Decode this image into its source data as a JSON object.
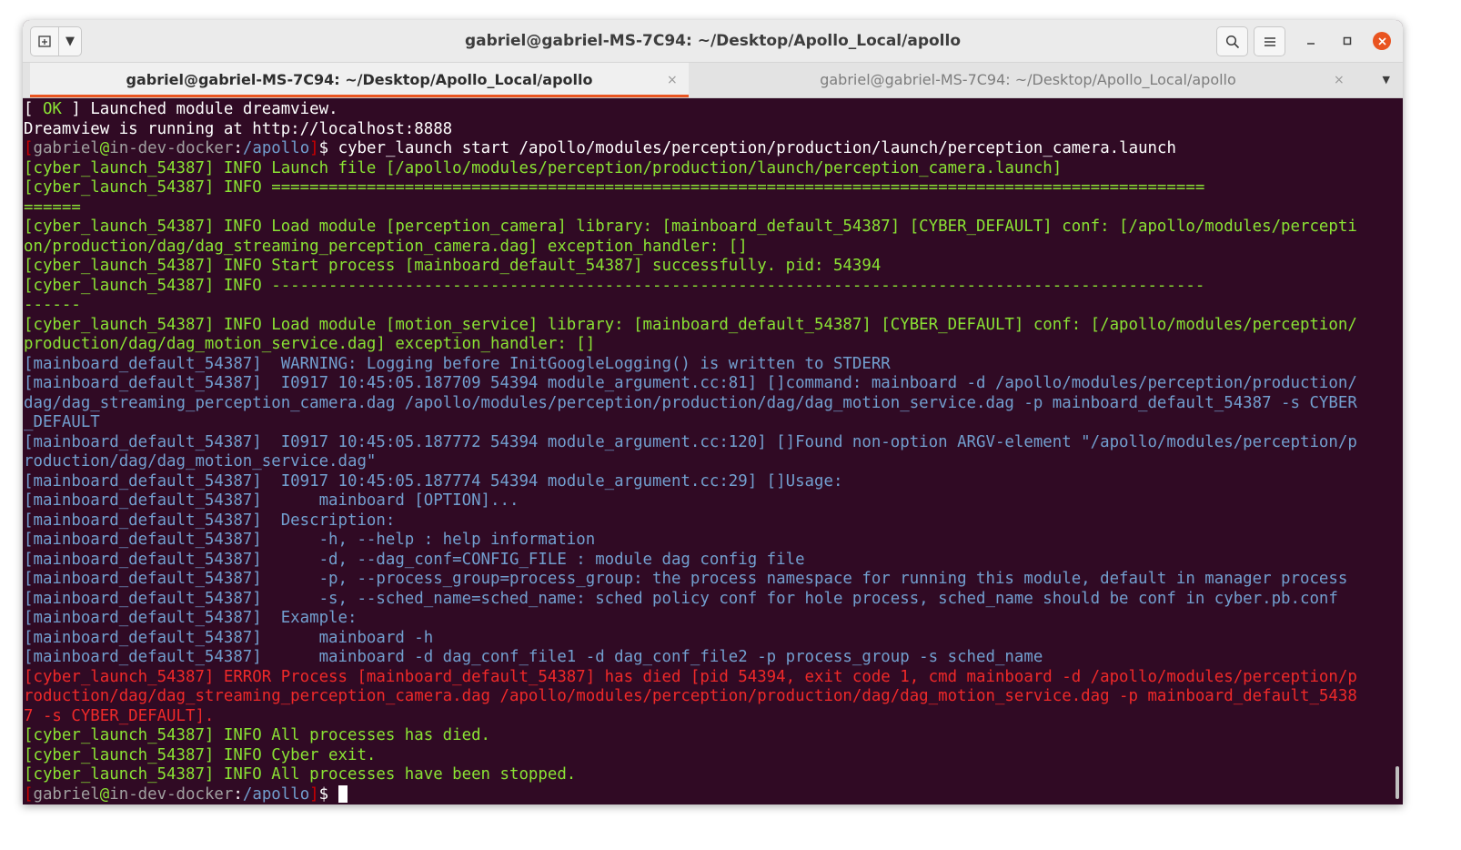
{
  "window": {
    "title": "gabriel@gabriel-MS-7C94: ~/Desktop/Apollo_Local/apollo",
    "search_icon": "search-icon",
    "menu_icon": "hamburger-icon"
  },
  "tabs": [
    {
      "label": "gabriel@gabriel-MS-7C94: ~/Desktop/Apollo_Local/apollo",
      "active": true
    },
    {
      "label": "gabriel@gabriel-MS-7C94: ~/Desktop/Apollo_Local/apollo",
      "active": false
    }
  ],
  "colors": {
    "terminal_bg": "#300a24",
    "accent": "#e95420",
    "green": "#8ae234",
    "blue": "#729fcf",
    "red": "#ef2929"
  },
  "terminal": {
    "prompt": {
      "user": "gabriel",
      "at": "@",
      "host": "in-dev-docker",
      "colon": ":",
      "path": "/apollo",
      "dollar": "$"
    },
    "lines": [
      [
        {
          "t": "[ ",
          "c": "c-white"
        },
        {
          "t": "OK",
          "c": "c-ok"
        },
        {
          "t": " ] Launched module dreamview.",
          "c": "c-white"
        }
      ],
      [
        {
          "t": "Dreamview is running at http://localhost:8888",
          "c": "c-white"
        }
      ],
      [
        {
          "t": "[",
          "c": "c-dred"
        },
        {
          "t": "gabriel",
          "c": "c-gray"
        },
        {
          "t": "@",
          "c": "c-green"
        },
        {
          "t": "in-dev-docker",
          "c": "c-gray"
        },
        {
          "t": ":",
          "c": "c-white"
        },
        {
          "t": "/apollo",
          "c": "c-blue"
        },
        {
          "t": "]",
          "c": "c-dred"
        },
        {
          "t": "$ cyber_launch start /apollo/modules/perception/production/launch/perception_camera.launch",
          "c": "c-white"
        }
      ],
      [
        {
          "t": "[cyber_launch_54387] INFO Launch file [/apollo/modules/perception/production/launch/perception_camera.launch]",
          "c": "c-green"
        }
      ],
      [
        {
          "t": "[cyber_launch_54387] INFO ==================================================================================================",
          "c": "c-green"
        }
      ],
      [
        {
          "t": "======",
          "c": "c-green"
        }
      ],
      [
        {
          "t": "[cyber_launch_54387] INFO Load module [perception_camera] library: [mainboard_default_54387] [CYBER_DEFAULT] conf: [/apollo/modules/percepti",
          "c": "c-green"
        }
      ],
      [
        {
          "t": "on/production/dag/dag_streaming_perception_camera.dag] exception_handler: []",
          "c": "c-green"
        }
      ],
      [
        {
          "t": "[cyber_launch_54387] INFO Start process [mainboard_default_54387] successfully. pid: 54394",
          "c": "c-green"
        }
      ],
      [
        {
          "t": "[cyber_launch_54387] INFO --------------------------------------------------------------------------------------------------",
          "c": "c-green"
        }
      ],
      [
        {
          "t": "------",
          "c": "c-green"
        }
      ],
      [
        {
          "t": "[cyber_launch_54387] INFO Load module [motion_service] library: [mainboard_default_54387] [CYBER_DEFAULT] conf: [/apollo/modules/perception/",
          "c": "c-green"
        }
      ],
      [
        {
          "t": "production/dag/dag_motion_service.dag] exception_handler: []",
          "c": "c-green"
        }
      ],
      [
        {
          "t": "[mainboard_default_54387]  WARNING: Logging before InitGoogleLogging() is written to STDERR",
          "c": "c-blue"
        }
      ],
      [
        {
          "t": "[mainboard_default_54387]  I0917 10:45:05.187709 54394 module_argument.cc:81] []command: mainboard -d /apollo/modules/perception/production/",
          "c": "c-blue"
        }
      ],
      [
        {
          "t": "dag/dag_streaming_perception_camera.dag /apollo/modules/perception/production/dag/dag_motion_service.dag -p mainboard_default_54387 -s CYBER",
          "c": "c-blue"
        }
      ],
      [
        {
          "t": "_DEFAULT",
          "c": "c-blue"
        }
      ],
      [
        {
          "t": "[mainboard_default_54387]  I0917 10:45:05.187772 54394 module_argument.cc:120] []Found non-option ARGV-element \"/apollo/modules/perception/p",
          "c": "c-blue"
        }
      ],
      [
        {
          "t": "roduction/dag/dag_motion_service.dag\"",
          "c": "c-blue"
        }
      ],
      [
        {
          "t": "[mainboard_default_54387]  I0917 10:45:05.187774 54394 module_argument.cc:29] []Usage:",
          "c": "c-blue"
        }
      ],
      [
        {
          "t": "[mainboard_default_54387]      mainboard [OPTION]...",
          "c": "c-blue"
        }
      ],
      [
        {
          "t": "[mainboard_default_54387]  Description:",
          "c": "c-blue"
        }
      ],
      [
        {
          "t": "[mainboard_default_54387]      -h, --help : help information",
          "c": "c-blue"
        }
      ],
      [
        {
          "t": "[mainboard_default_54387]      -d, --dag_conf=CONFIG_FILE : module dag config file",
          "c": "c-blue"
        }
      ],
      [
        {
          "t": "[mainboard_default_54387]      -p, --process_group=process_group: the process namespace for running this module, default in manager process",
          "c": "c-blue"
        }
      ],
      [
        {
          "t": "[mainboard_default_54387]      -s, --sched_name=sched_name: sched policy conf for hole process, sched_name should be conf in cyber.pb.conf",
          "c": "c-blue"
        }
      ],
      [
        {
          "t": "[mainboard_default_54387]  Example:",
          "c": "c-blue"
        }
      ],
      [
        {
          "t": "[mainboard_default_54387]      mainboard -h",
          "c": "c-blue"
        }
      ],
      [
        {
          "t": "[mainboard_default_54387]      mainboard -d dag_conf_file1 -d dag_conf_file2 -p process_group -s sched_name",
          "c": "c-blue"
        }
      ],
      [
        {
          "t": "[cyber_launch_54387] ERROR Process [mainboard_default_54387] has died [pid 54394, exit code 1, cmd mainboard -d /apollo/modules/perception/p",
          "c": "c-red"
        }
      ],
      [
        {
          "t": "roduction/dag/dag_streaming_perception_camera.dag /apollo/modules/perception/production/dag/dag_motion_service.dag -p mainboard_default_5438",
          "c": "c-red"
        }
      ],
      [
        {
          "t": "7 -s CYBER_DEFAULT].",
          "c": "c-red"
        }
      ],
      [
        {
          "t": "[cyber_launch_54387] INFO All processes has died.",
          "c": "c-green"
        }
      ],
      [
        {
          "t": "[cyber_launch_54387] INFO Cyber exit.",
          "c": "c-green"
        }
      ],
      [
        {
          "t": "[cyber_launch_54387] INFO All processes have been stopped.",
          "c": "c-green"
        }
      ],
      [
        {
          "t": "[",
          "c": "c-dred"
        },
        {
          "t": "gabriel",
          "c": "c-gray"
        },
        {
          "t": "@",
          "c": "c-green"
        },
        {
          "t": "in-dev-docker",
          "c": "c-gray"
        },
        {
          "t": ":",
          "c": "c-white"
        },
        {
          "t": "/apollo",
          "c": "c-blue"
        },
        {
          "t": "]",
          "c": "c-dred"
        },
        {
          "t": "$ ",
          "c": "c-white"
        }
      ]
    ]
  }
}
